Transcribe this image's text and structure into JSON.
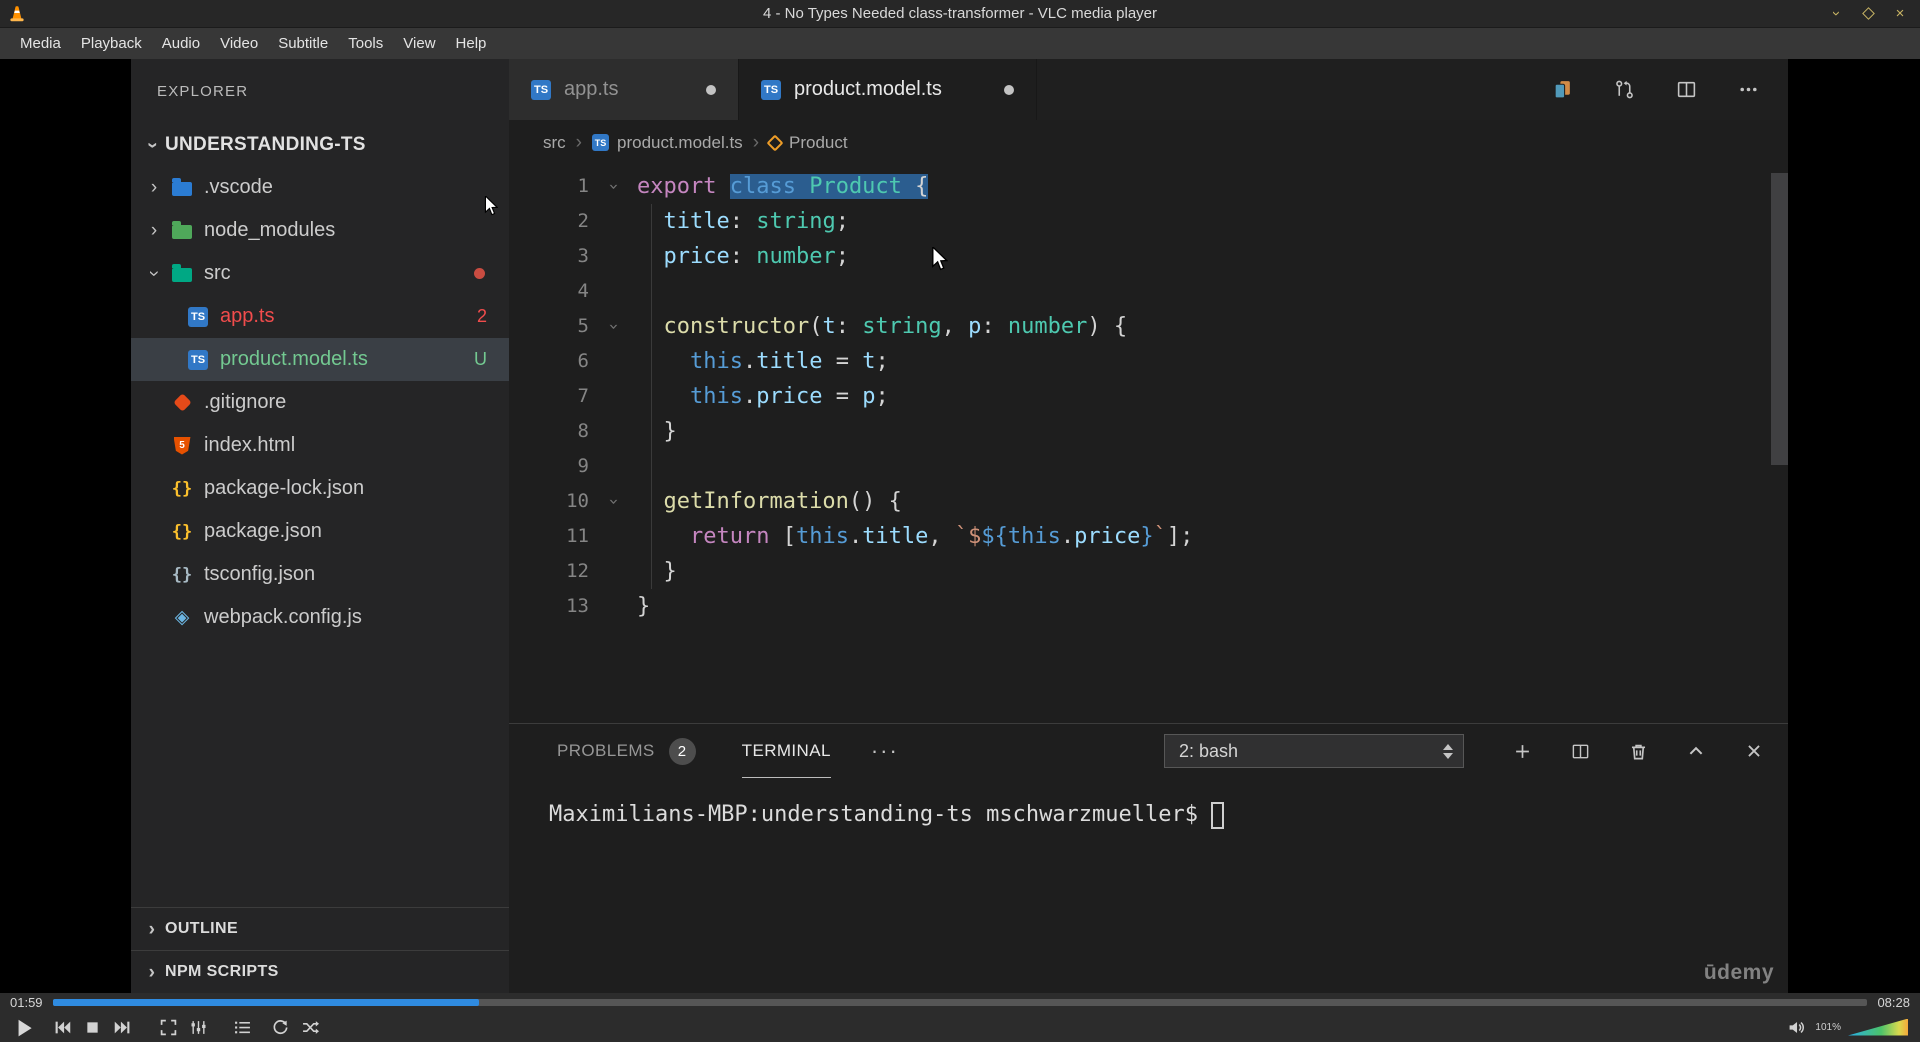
{
  "vlc": {
    "window_title": "4 - No Types Needed class-transformer - VLC media player",
    "menu": [
      "Media",
      "Playback",
      "Audio",
      "Video",
      "Subtitle",
      "Tools",
      "View",
      "Help"
    ],
    "time_current": "01:59",
    "time_total": "08:28",
    "progress_percent": 23.5,
    "volume_percent": "101%",
    "seek_fill_color": "#2f8be0"
  },
  "vscode": {
    "explorer": {
      "header": "EXPLORER",
      "root": "UNDERSTANDING-TS",
      "state_colors": {
        "error": "#f14c4c",
        "untracked": "#73c991"
      },
      "items": [
        {
          "label": ".vscode",
          "icon": "folder-vscode",
          "chevron": "right",
          "depth": 0
        },
        {
          "label": "node_modules",
          "icon": "folder-node",
          "chevron": "right",
          "depth": 0
        },
        {
          "label": "src",
          "icon": "folder-src",
          "chevron": "down",
          "depth": 0,
          "dot": true
        },
        {
          "label": "app.ts",
          "icon": "ts",
          "depth": 1,
          "badge": "2",
          "state": "error"
        },
        {
          "label": "product.model.ts",
          "icon": "ts",
          "depth": 1,
          "badge": "U",
          "state": "untracked",
          "selected": true
        },
        {
          "label": ".gitignore",
          "icon": "git",
          "depth": 0
        },
        {
          "label": "index.html",
          "icon": "html",
          "depth": 0
        },
        {
          "label": "package-lock.json",
          "icon": "json",
          "depth": 0
        },
        {
          "label": "package.json",
          "icon": "json",
          "depth": 0
        },
        {
          "label": "tsconfig.json",
          "icon": "json-grey",
          "depth": 0
        },
        {
          "label": "webpack.config.js",
          "icon": "webpack",
          "depth": 0
        }
      ],
      "sections": [
        "OUTLINE",
        "NPM SCRIPTS"
      ]
    },
    "tabs": [
      {
        "label": "app.ts",
        "icon": "ts",
        "modified": true,
        "active": false
      },
      {
        "label": "product.model.ts",
        "icon": "ts",
        "modified": true,
        "active": true
      }
    ],
    "breadcrumb": [
      {
        "label": "src"
      },
      {
        "label": "product.model.ts",
        "icon": "ts"
      },
      {
        "label": "Product",
        "icon": "class"
      }
    ],
    "code": {
      "colors": {
        "kw": "#c586c0",
        "blue": "#569cd6",
        "type": "#4ec9b0",
        "var": "#9cdcfe",
        "fn": "#dcdcaa",
        "str": "#ce9178",
        "plain": "#d4d4d4"
      },
      "selection_background": "#2b5d8f",
      "lines": [
        {
          "n": 1,
          "fold": true,
          "tokens": [
            [
              "export ",
              "kw"
            ],
            [
              "class ",
              "blue",
              true
            ],
            [
              "Product ",
              "type",
              true
            ],
            [
              "{",
              "plain",
              true
            ]
          ]
        },
        {
          "n": 2,
          "tokens": [
            [
              "  title",
              "var"
            ],
            [
              ": ",
              "plain"
            ],
            [
              "string",
              "type"
            ],
            [
              ";",
              "plain"
            ]
          ]
        },
        {
          "n": 3,
          "tokens": [
            [
              "  price",
              "var"
            ],
            [
              ": ",
              "plain"
            ],
            [
              "number",
              "type"
            ],
            [
              ";",
              "plain"
            ]
          ]
        },
        {
          "n": 4,
          "tokens": []
        },
        {
          "n": 5,
          "fold": true,
          "tokens": [
            [
              "  constructor",
              "fn"
            ],
            [
              "(",
              "plain"
            ],
            [
              "t",
              "var"
            ],
            [
              ": ",
              "plain"
            ],
            [
              "string",
              "type"
            ],
            [
              ", ",
              "plain"
            ],
            [
              "p",
              "var"
            ],
            [
              ": ",
              "plain"
            ],
            [
              "number",
              "type"
            ],
            [
              ") {",
              "plain"
            ]
          ]
        },
        {
          "n": 6,
          "tokens": [
            [
              "    this",
              "blue"
            ],
            [
              ".",
              "plain"
            ],
            [
              "title",
              "var"
            ],
            [
              " = ",
              "plain"
            ],
            [
              "t",
              "var"
            ],
            [
              ";",
              "plain"
            ]
          ]
        },
        {
          "n": 7,
          "tokens": [
            [
              "    this",
              "blue"
            ],
            [
              ".",
              "plain"
            ],
            [
              "price",
              "var"
            ],
            [
              " = ",
              "plain"
            ],
            [
              "p",
              "var"
            ],
            [
              ";",
              "plain"
            ]
          ]
        },
        {
          "n": 8,
          "tokens": [
            [
              "  }",
              "plain"
            ]
          ]
        },
        {
          "n": 9,
          "tokens": []
        },
        {
          "n": 10,
          "fold": true,
          "tokens": [
            [
              "  getInformation",
              "fn"
            ],
            [
              "() {",
              "plain"
            ]
          ]
        },
        {
          "n": 11,
          "tokens": [
            [
              "    return",
              "kw"
            ],
            [
              " [",
              "plain"
            ],
            [
              "this",
              "blue"
            ],
            [
              ".",
              "plain"
            ],
            [
              "title",
              "var"
            ],
            [
              ", ",
              "plain"
            ],
            [
              "`$",
              "str"
            ],
            [
              "${",
              "blue"
            ],
            [
              "this",
              "blue"
            ],
            [
              ".",
              "plain"
            ],
            [
              "price",
              "var"
            ],
            [
              "}",
              "blue"
            ],
            [
              "`",
              "str"
            ],
            [
              "];",
              "plain"
            ]
          ]
        },
        {
          "n": 12,
          "tokens": [
            [
              "  }",
              "plain"
            ]
          ]
        },
        {
          "n": 13,
          "tokens": [
            [
              "}",
              "plain"
            ]
          ]
        }
      ]
    },
    "panel": {
      "tabs": [
        {
          "label": "PROBLEMS",
          "badge": "2",
          "active": false
        },
        {
          "label": "TERMINAL",
          "active": true
        }
      ],
      "shell_selector": "2: bash",
      "terminal_prompt": "Maximilians-MBP:understanding-ts mschwarzmueller$"
    },
    "watermark": "ūdemy"
  }
}
